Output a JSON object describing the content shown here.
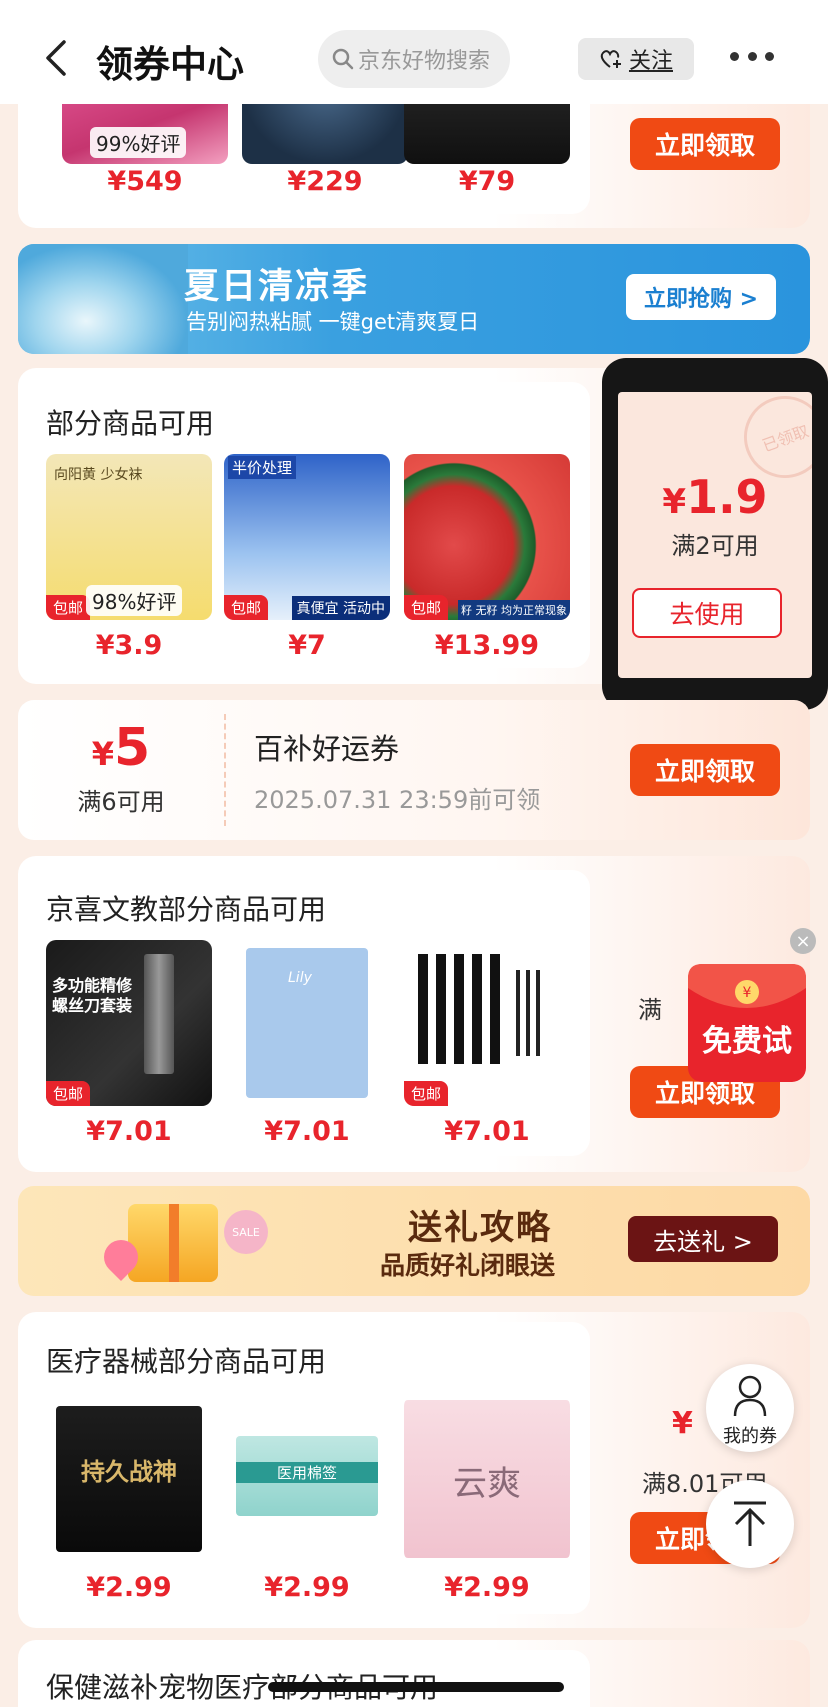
{
  "header": {
    "title": "领券中心",
    "search_placeholder": "京东好物搜索",
    "follow_label": "关注"
  },
  "card1": {
    "products": [
      {
        "price": "¥549",
        "rating": "99%好评"
      },
      {
        "price": "¥229"
      },
      {
        "price": "¥79"
      }
    ],
    "claim_label": "立即领取"
  },
  "summer_banner": {
    "title": "夏日清凉季",
    "subtitle": "告别闷热粘腻 一键get清爽夏日",
    "cta": "立即抢购 >"
  },
  "card2": {
    "title": "部分商品可用",
    "products": [
      {
        "price": "¥3.9",
        "rating": "98%好评",
        "tag": "包邮",
        "image_text": "向阳黄 少女袜"
      },
      {
        "price": "¥7",
        "tag": "包邮",
        "image_text": "半价处理",
        "image_caption": "真便宜 活动中"
      },
      {
        "price": "¥13.99",
        "tag": "包邮",
        "image_caption": "籽 无籽 均为正常现象"
      }
    ],
    "coupon": {
      "symbol": "¥",
      "amount": "1.9",
      "condition": "满2可用",
      "use_label": "去使用",
      "stamp": "已领取"
    }
  },
  "baibu_coupon": {
    "symbol": "¥",
    "amount": "5",
    "condition": "满6可用",
    "title": "百补好运券",
    "deadline": "2025.07.31 23:59前可领",
    "claim_label": "立即领取"
  },
  "card3": {
    "title": "京喜文教部分商品可用",
    "products": [
      {
        "price": "¥7.01",
        "tag": "包邮",
        "image_text": "多功能精修螺丝刀套装"
      },
      {
        "price": "¥7.01",
        "image_text": "Lily"
      },
      {
        "price": "¥7.01",
        "tag": "包邮"
      }
    ],
    "coupon_condition_partial": "满",
    "claim_label": "立即领取"
  },
  "gift_banner": {
    "title": "送礼攻略",
    "subtitle": "品质好礼闭眼送",
    "cta": "去送礼 >",
    "sale_tag": "SALE"
  },
  "card4": {
    "title": "医疗器械部分商品可用",
    "products": [
      {
        "price": "¥2.99",
        "image_text": "持久战神"
      },
      {
        "price": "¥2.99",
        "image_text": "医用棉签"
      },
      {
        "price": "¥2.99",
        "image_text": "云爽"
      }
    ],
    "coupon_symbol": "¥",
    "coupon_condition": "满8.01可用",
    "claim_label": "立即领取"
  },
  "card5": {
    "title": "保健滋补宠物医疗部分商品可用"
  },
  "floating": {
    "redpack_label": "免费试",
    "my_coupon_label": "我的券"
  },
  "colors": {
    "accent_red": "#e8242c",
    "claim_orange": "#f04a14",
    "summer_blue": "#2a94dd",
    "gift_brown": "#6b1414"
  }
}
